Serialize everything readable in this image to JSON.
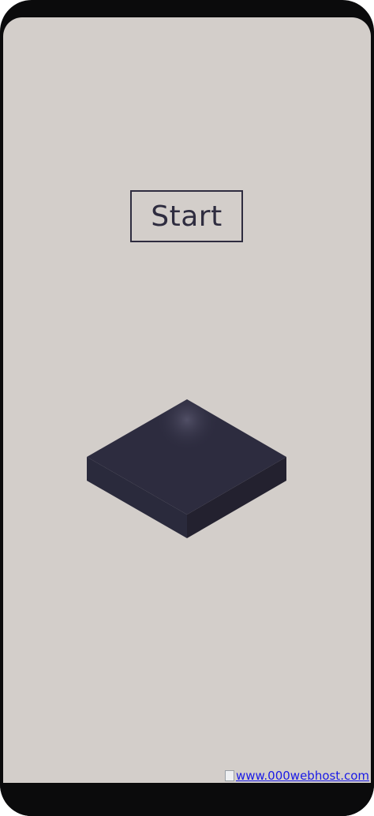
{
  "game": {
    "start_label": "Start"
  },
  "footer": {
    "link_text": "www.000webhost.com",
    "icon": "broken-image-icon"
  },
  "colors": {
    "background": "#d3ceca",
    "block_top": "#2d2c3f",
    "block_left": "#2a2a3c",
    "block_right": "#23212f",
    "text": "#2e2c3f",
    "link": "#1a1ae6",
    "device_frame": "#0b0b0c"
  }
}
